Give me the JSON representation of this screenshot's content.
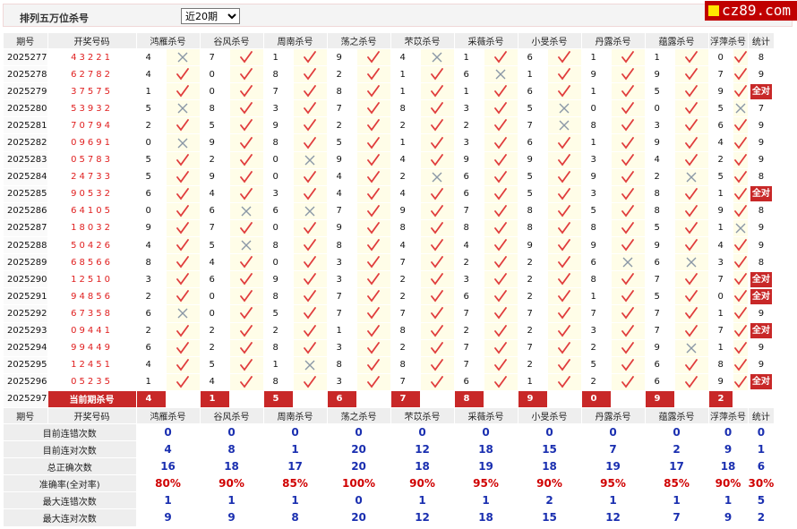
{
  "header": {
    "title": "排列五万位杀号",
    "select_value": "近20期",
    "logo": "cz89.com"
  },
  "colors": {
    "accent": "#c82828",
    "check": "#e03c3c",
    "cross": "#8a97a6",
    "stat_blue": "#1a2fb0",
    "stat_red": "#d00000"
  },
  "columns": [
    "期号",
    "开奖号码",
    "鸿雁杀号",
    "谷风杀号",
    "周南杀号",
    "荡之杀号",
    "芣苡杀号",
    "采薇杀号",
    "小旻杀号",
    "丹露杀号",
    "蕴露杀号",
    "浮萍杀号",
    "统计"
  ],
  "rows": [
    {
      "period": "2025277",
      "code": "43221",
      "nums": [
        "4",
        "7",
        "1",
        "9",
        "4",
        "1",
        "6",
        "1",
        "1",
        "0"
      ],
      "marks": [
        "x",
        "c",
        "c",
        "c",
        "x",
        "c",
        "c",
        "c",
        "c",
        "c"
      ],
      "stat": "8"
    },
    {
      "period": "2025278",
      "code": "62782",
      "nums": [
        "4",
        "0",
        "8",
        "2",
        "1",
        "6",
        "1",
        "9",
        "9",
        "7"
      ],
      "marks": [
        "c",
        "c",
        "c",
        "c",
        "c",
        "x",
        "c",
        "c",
        "c",
        "c"
      ],
      "stat": "9"
    },
    {
      "period": "2025279",
      "code": "37575",
      "nums": [
        "1",
        "0",
        "7",
        "8",
        "1",
        "1",
        "6",
        "1",
        "5",
        "9"
      ],
      "marks": [
        "c",
        "c",
        "c",
        "c",
        "c",
        "c",
        "c",
        "c",
        "c",
        "c"
      ],
      "stat": "全对"
    },
    {
      "period": "2025280",
      "code": "53932",
      "nums": [
        "5",
        "8",
        "3",
        "7",
        "8",
        "3",
        "5",
        "0",
        "0",
        "5"
      ],
      "marks": [
        "x",
        "c",
        "c",
        "c",
        "c",
        "c",
        "x",
        "c",
        "c",
        "x"
      ],
      "stat": "7"
    },
    {
      "period": "2025281",
      "code": "70794",
      "nums": [
        "2",
        "5",
        "9",
        "2",
        "2",
        "2",
        "7",
        "8",
        "3",
        "6"
      ],
      "marks": [
        "c",
        "c",
        "c",
        "c",
        "c",
        "c",
        "x",
        "c",
        "c",
        "c"
      ],
      "stat": "9"
    },
    {
      "period": "2025282",
      "code": "09691",
      "nums": [
        "0",
        "9",
        "8",
        "5",
        "1",
        "3",
        "6",
        "1",
        "9",
        "4"
      ],
      "marks": [
        "x",
        "c",
        "c",
        "c",
        "c",
        "c",
        "c",
        "c",
        "c",
        "c"
      ],
      "stat": "9"
    },
    {
      "period": "2025283",
      "code": "05783",
      "nums": [
        "5",
        "2",
        "0",
        "9",
        "4",
        "9",
        "9",
        "3",
        "4",
        "2"
      ],
      "marks": [
        "c",
        "c",
        "x",
        "c",
        "c",
        "c",
        "c",
        "c",
        "c",
        "c"
      ],
      "stat": "9"
    },
    {
      "period": "2025284",
      "code": "24733",
      "nums": [
        "5",
        "9",
        "0",
        "4",
        "2",
        "6",
        "5",
        "9",
        "2",
        "5"
      ],
      "marks": [
        "c",
        "c",
        "c",
        "c",
        "x",
        "c",
        "c",
        "c",
        "x",
        "c"
      ],
      "stat": "8"
    },
    {
      "period": "2025285",
      "code": "90532",
      "nums": [
        "6",
        "4",
        "3",
        "4",
        "4",
        "6",
        "5",
        "3",
        "8",
        "1"
      ],
      "marks": [
        "c",
        "c",
        "c",
        "c",
        "c",
        "c",
        "c",
        "c",
        "c",
        "c"
      ],
      "stat": "全对"
    },
    {
      "period": "2025286",
      "code": "64105",
      "nums": [
        "0",
        "6",
        "6",
        "7",
        "9",
        "7",
        "8",
        "5",
        "8",
        "9"
      ],
      "marks": [
        "c",
        "x",
        "x",
        "c",
        "c",
        "c",
        "c",
        "c",
        "c",
        "c"
      ],
      "stat": "8"
    },
    {
      "period": "2025287",
      "code": "18032",
      "nums": [
        "9",
        "7",
        "0",
        "9",
        "8",
        "8",
        "8",
        "8",
        "5",
        "1"
      ],
      "marks": [
        "c",
        "c",
        "c",
        "c",
        "c",
        "c",
        "c",
        "c",
        "c",
        "x"
      ],
      "stat": "9"
    },
    {
      "period": "2025288",
      "code": "50426",
      "nums": [
        "4",
        "5",
        "8",
        "8",
        "4",
        "4",
        "9",
        "9",
        "9",
        "4"
      ],
      "marks": [
        "c",
        "x",
        "c",
        "c",
        "c",
        "c",
        "c",
        "c",
        "c",
        "c"
      ],
      "stat": "9"
    },
    {
      "period": "2025289",
      "code": "68566",
      "nums": [
        "8",
        "4",
        "0",
        "3",
        "7",
        "2",
        "2",
        "6",
        "6",
        "3"
      ],
      "marks": [
        "c",
        "c",
        "c",
        "c",
        "c",
        "c",
        "c",
        "x",
        "x",
        "c"
      ],
      "stat": "8"
    },
    {
      "period": "2025290",
      "code": "12510",
      "nums": [
        "3",
        "6",
        "9",
        "3",
        "2",
        "3",
        "2",
        "8",
        "7",
        "7"
      ],
      "marks": [
        "c",
        "c",
        "c",
        "c",
        "c",
        "c",
        "c",
        "c",
        "c",
        "c"
      ],
      "stat": "全对"
    },
    {
      "period": "2025291",
      "code": "94856",
      "nums": [
        "2",
        "0",
        "8",
        "7",
        "2",
        "6",
        "2",
        "1",
        "5",
        "0"
      ],
      "marks": [
        "c",
        "c",
        "c",
        "c",
        "c",
        "c",
        "c",
        "c",
        "c",
        "c"
      ],
      "stat": "全对"
    },
    {
      "period": "2025292",
      "code": "67358",
      "nums": [
        "6",
        "0",
        "5",
        "7",
        "7",
        "7",
        "7",
        "7",
        "7",
        "1"
      ],
      "marks": [
        "x",
        "c",
        "c",
        "c",
        "c",
        "c",
        "c",
        "c",
        "c",
        "c"
      ],
      "stat": "9"
    },
    {
      "period": "2025293",
      "code": "09441",
      "nums": [
        "2",
        "2",
        "2",
        "1",
        "8",
        "2",
        "2",
        "3",
        "7",
        "7"
      ],
      "marks": [
        "c",
        "c",
        "c",
        "c",
        "c",
        "c",
        "c",
        "c",
        "c",
        "c"
      ],
      "stat": "全对"
    },
    {
      "period": "2025294",
      "code": "99449",
      "nums": [
        "6",
        "2",
        "8",
        "3",
        "2",
        "7",
        "7",
        "2",
        "9",
        "1"
      ],
      "marks": [
        "c",
        "c",
        "c",
        "c",
        "c",
        "c",
        "c",
        "c",
        "x",
        "c"
      ],
      "stat": "9"
    },
    {
      "period": "2025295",
      "code": "12451",
      "nums": [
        "4",
        "5",
        "1",
        "8",
        "8",
        "7",
        "2",
        "5",
        "6",
        "8"
      ],
      "marks": [
        "c",
        "c",
        "x",
        "c",
        "c",
        "c",
        "c",
        "c",
        "c",
        "c"
      ],
      "stat": "9"
    },
    {
      "period": "2025296",
      "code": "05235",
      "nums": [
        "1",
        "4",
        "8",
        "3",
        "7",
        "6",
        "1",
        "2",
        "6",
        "9"
      ],
      "marks": [
        "c",
        "c",
        "c",
        "c",
        "c",
        "c",
        "c",
        "c",
        "c",
        "c"
      ],
      "stat": "全对"
    }
  ],
  "current": {
    "period": "2025297",
    "label": "当前期杀号",
    "nums": [
      "4",
      "1",
      "5",
      "6",
      "7",
      "8",
      "9",
      "0",
      "9",
      "2"
    ]
  },
  "stats": [
    {
      "label": "目前连错次数",
      "values": [
        "0",
        "0",
        "0",
        "0",
        "0",
        "0",
        "0",
        "0",
        "0",
        "0",
        "0"
      ],
      "red": false
    },
    {
      "label": "目前连对次数",
      "values": [
        "4",
        "8",
        "1",
        "20",
        "12",
        "18",
        "15",
        "7",
        "2",
        "9",
        "1"
      ],
      "red": false
    },
    {
      "label": "总正确次数",
      "values": [
        "16",
        "18",
        "17",
        "20",
        "18",
        "19",
        "18",
        "19",
        "17",
        "18",
        "6"
      ],
      "red": false
    },
    {
      "label": "准确率(全对率)",
      "values": [
        "80%",
        "90%",
        "85%",
        "100%",
        "90%",
        "95%",
        "90%",
        "95%",
        "85%",
        "90%",
        "30%"
      ],
      "red": true
    },
    {
      "label": "最大连错次数",
      "values": [
        "1",
        "1",
        "1",
        "0",
        "1",
        "1",
        "2",
        "1",
        "1",
        "1",
        "5"
      ],
      "red": false
    },
    {
      "label": "最大连对次数",
      "values": [
        "9",
        "9",
        "8",
        "20",
        "12",
        "18",
        "15",
        "12",
        "7",
        "9",
        "2"
      ],
      "red": false
    }
  ]
}
